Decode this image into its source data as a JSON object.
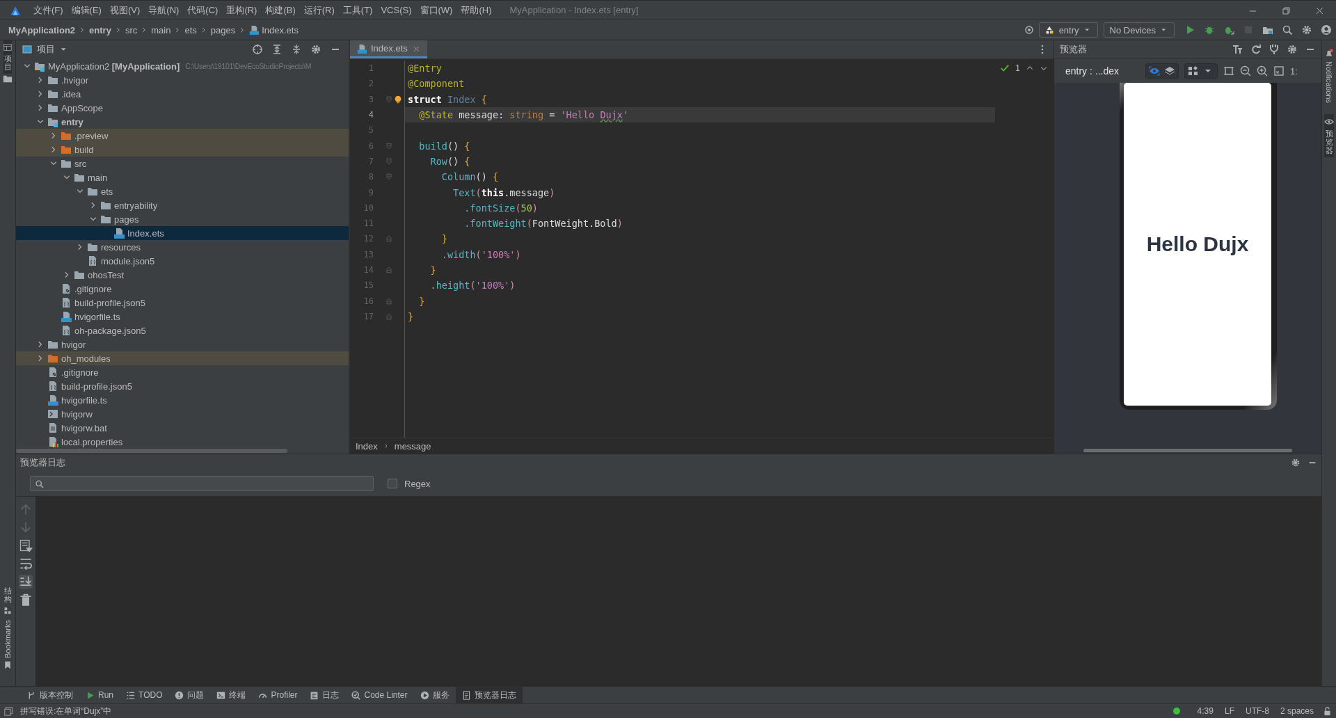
{
  "title_bar": {
    "menus": [
      "文件(F)",
      "编辑(E)",
      "视图(V)",
      "导航(N)",
      "代码(C)",
      "重构(R)",
      "构建(B)",
      "运行(R)",
      "工具(T)",
      "VCS(S)",
      "窗口(W)",
      "帮助(H)"
    ],
    "title": "MyApplication - Index.ets [entry]"
  },
  "nav_bar": {
    "breadcrumb": [
      {
        "label": "MyApplication2",
        "kind": "project"
      },
      {
        "label": "entry",
        "kind": "module"
      },
      {
        "label": "src",
        "kind": "folder"
      },
      {
        "label": "main",
        "kind": "folder"
      },
      {
        "label": "ets",
        "kind": "folder"
      },
      {
        "label": "pages",
        "kind": "folder"
      },
      {
        "label": "Index.ets",
        "kind": "file"
      }
    ],
    "module_selector": "entry",
    "device_selector": "No Devices",
    "stop_disabled": true
  },
  "left_strip": {
    "top": "项目",
    "bottom": [
      {
        "label": "结构",
        "kind": "cjk"
      },
      {
        "label": "Bookmarks",
        "kind": "latin"
      }
    ]
  },
  "project_panel": {
    "title": "项目",
    "tree": [
      {
        "label": "MyApplication2 **[MyApplication]**",
        "path": "C:\\Users\\19101\\DevEcoStudioProjects\\M",
        "kind": "module",
        "expanded": true,
        "selected": false,
        "excluded": false,
        "children": [
          {
            "label": ".hvigor",
            "kind": "folder",
            "expanded": false,
            "selected": false,
            "excluded": false
          },
          {
            "label": ".idea",
            "kind": "folder",
            "expanded": false,
            "selected": false,
            "excluded": false
          },
          {
            "label": "AppScope",
            "kind": "folder",
            "expanded": false,
            "selected": false,
            "excluded": false
          },
          {
            "label": "entry",
            "kind": "module",
            "expanded": true,
            "selected": false,
            "excluded": false,
            "children": [
              {
                "label": ".preview",
                "kind": "folder",
                "expanded": false,
                "selected": false,
                "excluded": true
              },
              {
                "label": "build",
                "kind": "folder",
                "expanded": false,
                "selected": false,
                "excluded": true
              },
              {
                "label": "src",
                "kind": "folder",
                "expanded": true,
                "selected": false,
                "excluded": false,
                "children": [
                  {
                    "label": "main",
                    "kind": "folder",
                    "expanded": true,
                    "selected": false,
                    "excluded": false,
                    "children": [
                      {
                        "label": "ets",
                        "kind": "folder",
                        "expanded": true,
                        "selected": false,
                        "excluded": false,
                        "children": [
                          {
                            "label": "entryability",
                            "kind": "folder",
                            "expanded": false,
                            "selected": false,
                            "excluded": false
                          },
                          {
                            "label": "pages",
                            "kind": "folder",
                            "expanded": true,
                            "selected": false,
                            "excluded": false,
                            "children": [
                              {
                                "label": "Index.ets",
                                "kind": "ets",
                                "selected": true,
                                "excluded": false
                              }
                            ]
                          }
                        ]
                      },
                      {
                        "label": "resources",
                        "kind": "folder",
                        "expanded": false,
                        "selected": false,
                        "excluded": false
                      },
                      {
                        "label": "module.json5",
                        "kind": "json",
                        "selected": false,
                        "excluded": false
                      }
                    ]
                  },
                  {
                    "label": "ohosTest",
                    "kind": "folder",
                    "expanded": false,
                    "selected": false,
                    "excluded": false
                  }
                ]
              },
              {
                "label": ".gitignore",
                "kind": "ignore",
                "selected": false,
                "excluded": false
              },
              {
                "label": "build-profile.json5",
                "kind": "json",
                "selected": false,
                "excluded": false
              },
              {
                "label": "hvigorfile.ts",
                "kind": "ts",
                "selected": false,
                "excluded": false
              },
              {
                "label": "oh-package.json5",
                "kind": "json",
                "selected": false,
                "excluded": false
              }
            ]
          },
          {
            "label": "hvigor",
            "kind": "folder",
            "expanded": false,
            "selected": false,
            "excluded": false
          },
          {
            "label": "oh_modules",
            "kind": "folder",
            "expanded": false,
            "selected": false,
            "excluded": true
          },
          {
            "label": ".gitignore",
            "kind": "ignore",
            "selected": false,
            "excluded": false
          },
          {
            "label": "build-profile.json5",
            "kind": "json",
            "selected": false,
            "excluded": false
          },
          {
            "label": "hvigorfile.ts",
            "kind": "ts",
            "selected": false,
            "excluded": false
          },
          {
            "label": "hvigorw",
            "kind": "shell",
            "selected": false,
            "excluded": false
          },
          {
            "label": "hvigorw.bat",
            "kind": "text",
            "selected": false,
            "excluded": false
          },
          {
            "label": "local.properties",
            "kind": "properties",
            "selected": false,
            "excluded": false
          }
        ]
      }
    ]
  },
  "editor": {
    "tabs": [
      {
        "label": "Index.ets",
        "selected": true
      }
    ],
    "inspection_count": "1",
    "lines": [
      {
        "number": "1",
        "current": false,
        "tokens": [
          {
            "t": "@Entry",
            "kind": "ann"
          }
        ]
      },
      {
        "number": "2",
        "current": false,
        "tokens": [
          {
            "t": "@Component",
            "kind": "ann"
          }
        ]
      },
      {
        "number": "3",
        "current": false,
        "fold_start": true,
        "bulb": true,
        "tokens": [
          {
            "t": "struct ",
            "kind": "kw"
          },
          {
            "t": "Index ",
            "kind": "cls"
          },
          {
            "t": "{",
            "kind": "brace"
          }
        ]
      },
      {
        "number": "4",
        "current": true,
        "tokens": [
          {
            "t": "  @State",
            "kind": "ann"
          },
          {
            "t": " message: ",
            "kind": "plain"
          },
          {
            "t": "string",
            "kind": "type"
          },
          {
            "t": " = ",
            "kind": "plain"
          },
          {
            "t": "'Hello ",
            "kind": "str"
          },
          {
            "t": "Dujx",
            "kind": "typo"
          },
          {
            "t": "'",
            "kind": "str"
          }
        ]
      },
      {
        "number": "5",
        "current": false
      },
      {
        "number": "6",
        "current": false,
        "fold_start": true,
        "tokens": [
          {
            "t": "  build",
            "kind": "fn"
          },
          {
            "t": "() ",
            "kind": "plain"
          },
          {
            "t": "{",
            "kind": "brace"
          }
        ]
      },
      {
        "number": "7",
        "current": false,
        "fold_start": true,
        "tokens": [
          {
            "t": "    Row",
            "kind": "fn"
          },
          {
            "t": "() ",
            "kind": "plain"
          },
          {
            "t": "{",
            "kind": "brace"
          }
        ]
      },
      {
        "number": "8",
        "current": false,
        "fold_start": true,
        "tokens": [
          {
            "t": "      Column",
            "kind": "fn"
          },
          {
            "t": "() ",
            "kind": "plain"
          },
          {
            "t": "{",
            "kind": "brace"
          }
        ]
      },
      {
        "number": "9",
        "current": false,
        "tokens": [
          {
            "t": "        Text",
            "kind": "fn"
          },
          {
            "t": "(",
            "kind": "paren"
          },
          {
            "t": "this",
            "kind": "kw"
          },
          {
            "t": ".message",
            "kind": "plain"
          },
          {
            "t": ")",
            "kind": "paren"
          }
        ]
      },
      {
        "number": "10",
        "current": false,
        "tokens": [
          {
            "t": "          .fontSize",
            "kind": "fn"
          },
          {
            "t": "(",
            "kind": "paren"
          },
          {
            "t": "50",
            "kind": "num"
          },
          {
            "t": ")",
            "kind": "paren"
          }
        ]
      },
      {
        "number": "11",
        "current": false,
        "tokens": [
          {
            "t": "          .fontWeight",
            "kind": "fn"
          },
          {
            "t": "(",
            "kind": "paren"
          },
          {
            "t": "FontWeight.Bold",
            "kind": "plain"
          },
          {
            "t": ")",
            "kind": "paren"
          }
        ]
      },
      {
        "number": "12",
        "current": false,
        "fold_end": true,
        "tokens": [
          {
            "t": "      }",
            "kind": "brace"
          }
        ]
      },
      {
        "number": "13",
        "current": false,
        "tokens": [
          {
            "t": "      .width",
            "kind": "fn"
          },
          {
            "t": "(",
            "kind": "paren"
          },
          {
            "t": "'100%'",
            "kind": "str"
          },
          {
            "t": ")",
            "kind": "paren"
          }
        ]
      },
      {
        "number": "14",
        "current": false,
        "fold_end": true,
        "tokens": [
          {
            "t": "    }",
            "kind": "brace"
          }
        ]
      },
      {
        "number": "15",
        "current": false,
        "tokens": [
          {
            "t": "    .height",
            "kind": "fn"
          },
          {
            "t": "(",
            "kind": "paren"
          },
          {
            "t": "'100%'",
            "kind": "str"
          },
          {
            "t": ")",
            "kind": "paren"
          }
        ]
      },
      {
        "number": "16",
        "current": false,
        "fold_end": true,
        "tokens": [
          {
            "t": "  }",
            "kind": "brace"
          }
        ]
      },
      {
        "number": "17",
        "current": false,
        "fold_end": true,
        "tokens": [
          {
            "t": "}",
            "kind": "brace"
          }
        ]
      }
    ],
    "breadcrumb": [
      "Index",
      "message"
    ]
  },
  "preview_panel": {
    "title": "预览器",
    "target": "entry : ...dex",
    "zoom_label": "1:",
    "screen_text": "Hello Dujx"
  },
  "right_strip": [
    {
      "label": "Notifications",
      "kind": "latin"
    },
    {
      "label": "预览器",
      "kind": "cjk"
    }
  ],
  "log_panel": {
    "title": "预览器日志",
    "regex": {
      "label": "Regex",
      "checked": false
    }
  },
  "tool_tabs": [
    {
      "label": "版本控制",
      "kind": "branch",
      "selected": false
    },
    {
      "label": "Run",
      "kind": "run",
      "selected": false
    },
    {
      "label": "TODO",
      "kind": "list",
      "selected": false
    },
    {
      "label": "问题",
      "kind": "alert",
      "selected": false
    },
    {
      "label": "终端",
      "kind": "terminal",
      "selected": false
    },
    {
      "label": "Profiler",
      "kind": "gauge",
      "selected": false
    },
    {
      "label": "日志",
      "kind": "log",
      "selected": false
    },
    {
      "label": "Code Linter",
      "kind": "linter",
      "selected": false
    },
    {
      "label": "服务",
      "kind": "service",
      "selected": false
    },
    {
      "label": "预览器日志",
      "kind": "doc",
      "selected": true
    }
  ],
  "status_bar": {
    "message": "拼写错误:在单词“Dujx”中",
    "items": [
      "4:39",
      "LF",
      "UTF-8",
      "2 spaces"
    ]
  }
}
